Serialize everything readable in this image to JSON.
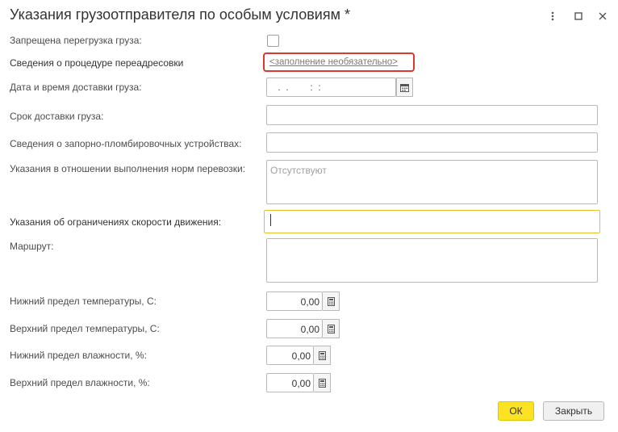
{
  "window": {
    "title": "Указания грузоотправителя по особым условиям *"
  },
  "form": {
    "reload_forbidden_label": "Запрещена перегрузка груза:",
    "redirect_label": "Сведения о процедуре переадресовки",
    "redirect_link": "<заполнение необязательно>",
    "delivery_datetime_label": "Дата и время доставки груза:",
    "delivery_datetime_mask": " .  .        :  :",
    "delivery_term_label": "Срок доставки груза:",
    "seal_devices_label": "Сведения о запорно-пломбировочных устройствах:",
    "transport_norms_label": "Указания в отношении выполнения норм перевозки:",
    "transport_norms_placeholder": "Отсутствуют",
    "speed_limits_label": "Указания об ограничениях скорости движения:",
    "route_label": "Маршрут:",
    "temp_min_label": "Нижний предел температуры, С:",
    "temp_min_value": "0,00",
    "temp_max_label": "Верхний предел температуры, С:",
    "temp_max_value": "0,00",
    "humidity_min_label": "Нижний предел влажности, %:",
    "humidity_min_value": "0,00",
    "humidity_max_label": "Верхний предел влажности, %:",
    "humidity_max_value": "0,00"
  },
  "buttons": {
    "ok": "ОК",
    "close": "Закрыть"
  },
  "icons": {
    "more": "more-vertical-icon",
    "maximize": "maximize-icon",
    "close": "close-icon",
    "calendar": "calendar-icon",
    "calculator": "calculator-icon"
  }
}
